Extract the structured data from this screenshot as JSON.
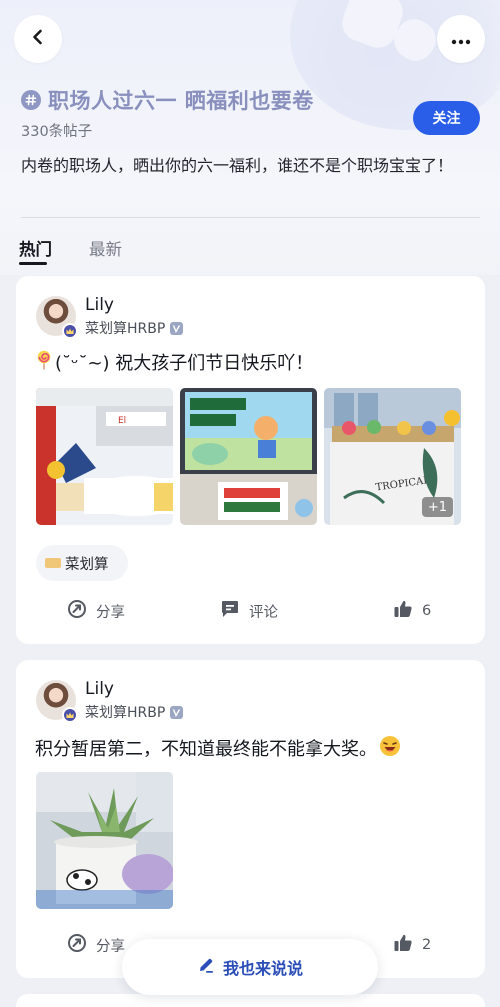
{
  "header": {
    "topic_title": "职场人过六一 晒福利也要卷",
    "post_count": "330条帖子",
    "follow_label": "关注",
    "description": "内卷的职场人，晒出你的六一福利，谁还不是个职场宝宝了！"
  },
  "tabs": [
    {
      "label": "热门",
      "active": true
    },
    {
      "label": "最新",
      "active": false
    }
  ],
  "posts": [
    {
      "author": "Lily",
      "role": "菜划算HRBP",
      "text": "(˘ᵕ˘~) 祝大孩子们节日快乐吖！",
      "extra_images": "+1",
      "tag": "菜划算",
      "share_label": "分享",
      "comment_label": "评论",
      "likes": "6"
    },
    {
      "author": "Lily",
      "role": "菜划算HRBP",
      "text": "积分暂居第二，不知道最终能不能拿大奖。",
      "share_label": "分享",
      "likes": "2"
    }
  ],
  "compose_button": "我也来说说",
  "colors": {
    "accent": "#2a5ee8",
    "topic_title": "#8990be",
    "compose_text": "#2a4db8"
  },
  "icons": [
    "back-icon",
    "more-icon",
    "hash-icon",
    "share-icon",
    "comment-icon",
    "like-icon",
    "edit-icon"
  ]
}
